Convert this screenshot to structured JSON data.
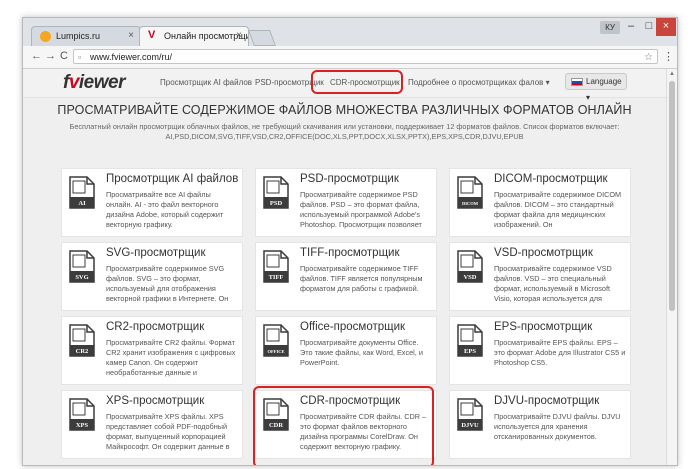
{
  "browser": {
    "tabs": [
      {
        "label": "Lumpics.ru",
        "close": "×"
      },
      {
        "label": "Онлайн просмотрщик",
        "close": "×"
      }
    ],
    "window_user": "КУ",
    "window_min": "–",
    "window_max": "□",
    "window_close": "×",
    "nav_back": "←",
    "nav_forward": "→",
    "nav_reload": "C",
    "url": "www.fviewer.com/ru/",
    "bookmark_star": "☆",
    "menu": "⋮"
  },
  "site": {
    "logo_prefix": "f",
    "logo_v": "v",
    "logo_suffix": "iewer",
    "nav": [
      "Просмотрщик AI файлов",
      "PSD-просмотрщик",
      "CDR-просмотрщик",
      "Подробнее о просмотрщиках фалов ▾"
    ],
    "language_label": "Language ▾",
    "headline": "ПРОСМАТРИВАЙТЕ СОДЕРЖИМОЕ ФАЙЛОВ МНОЖЕСТВА РАЗЛИЧНЫХ ФОРМАТОВ ОНЛАЙН",
    "subtext": "Бесплатный онлайн просмотрщик облачных файлов, не требующий скачивания или установки, поддерживает 12 форматов файлов. Список форматов включает: AI,PSD,DICOM,SVG,TIFF,VSD,CR2,OFFICE(DOC,XLS,PPT,DOCX,XLSX,PPTX),EPS,XPS,CDR,DJVU,EPUB"
  },
  "cards": [
    {
      "title": "Просмотрщик AI файлов",
      "icon_label": "AI",
      "icon_name": "ai-file-icon",
      "icon_color": "#3c3c3c",
      "desc": "Просматривайте все AI файлы онлайн. AI - это файл векторного дизайна Adobe, который содержит векторную графику."
    },
    {
      "title": "PSD-просмотрщик",
      "icon_label": "PSD",
      "icon_name": "psd-file-icon",
      "icon_color": "#3c3c3c",
      "desc": "Просматривайте содержимое PSD файлов. PSD – это формат файла, используемый программой Adobe's Photoshop. Просмотрщик позволяет"
    },
    {
      "title": "DICOM-просмотрщик",
      "icon_label": "DICOM",
      "icon_name": "dicom-file-icon",
      "icon_color": "#3c3c3c",
      "desc": "Просматривайте содержимое DICOM файлов. DICOM – это стандартный формат файла для медицинских изображений. Он"
    },
    {
      "title": "SVG-просмотрщик",
      "icon_label": "SVG",
      "icon_name": "svg-file-icon",
      "icon_color": "#3c3c3c",
      "desc": "Просматривайте содержимое SVG файлов. SVG – это формат, используемый для отображения векторной графики в Интернете. Он"
    },
    {
      "title": "TIFF-просмотрщик",
      "icon_label": "TIFF",
      "icon_name": "tiff-file-icon",
      "icon_color": "#3c3c3c",
      "desc": "Просматривайте содержимое TIFF файлов. TIFF является популярным форматом для работы с графикой."
    },
    {
      "title": "VSD-просмотрщик",
      "icon_label": "VSD",
      "icon_name": "vsd-file-icon",
      "icon_color": "#3c3c3c",
      "desc": "Просматривайте содержимое VSD файлов. VSD – это специальный формат, используемый в Microsoft Visio, которая используется для"
    },
    {
      "title": "CR2-просмотрщик",
      "icon_label": "CR2",
      "icon_name": "cr2-file-icon",
      "icon_color": "#3c3c3c",
      "desc": "Просматривайте CR2 файлы. Формат CR2 хранит изображения с цифровых камер Canon. Он содержит необработанные данные и"
    },
    {
      "title": "Office-просмотрщик",
      "icon_label": "OFFICE",
      "icon_name": "office-file-icon",
      "icon_color": "#3c3c3c",
      "desc": "Просматривайте документы Office. Это такие файлы, как Word, Excel, и PowerPoint."
    },
    {
      "title": "EPS-просмотрщик",
      "icon_label": "EPS",
      "icon_name": "eps-file-icon",
      "icon_color": "#3c3c3c",
      "desc": "Просматривайте EPS файлы. EPS – это формат Adobe для Illustrator CS5 и Photoshop CS5."
    },
    {
      "title": "XPS-просмотрщик",
      "icon_label": "XPS",
      "icon_name": "xps-file-icon",
      "icon_color": "#3c3c3c",
      "desc": "Просматривайте XPS файлы. XPS представляет собой PDF-подобный формат, выпущенный корпорацией Майкрософт. Он содержит данные в"
    },
    {
      "title": "CDR-просмотрщик",
      "icon_label": "CDR",
      "icon_name": "cdr-file-icon",
      "icon_color": "#3c3c3c",
      "desc": "Просматривайте CDR файлы. CDR – это формат файлов векторного дизайна программы CorelDraw. Он содержит векторную графику."
    },
    {
      "title": "DJVU-просмотрщик",
      "icon_label": "DJVU",
      "icon_name": "djvu-file-icon",
      "icon_color": "#3c3c3c",
      "desc": "Просматривайте DJVU файлы. DJVU используется для хранения отсканированных документов."
    }
  ]
}
